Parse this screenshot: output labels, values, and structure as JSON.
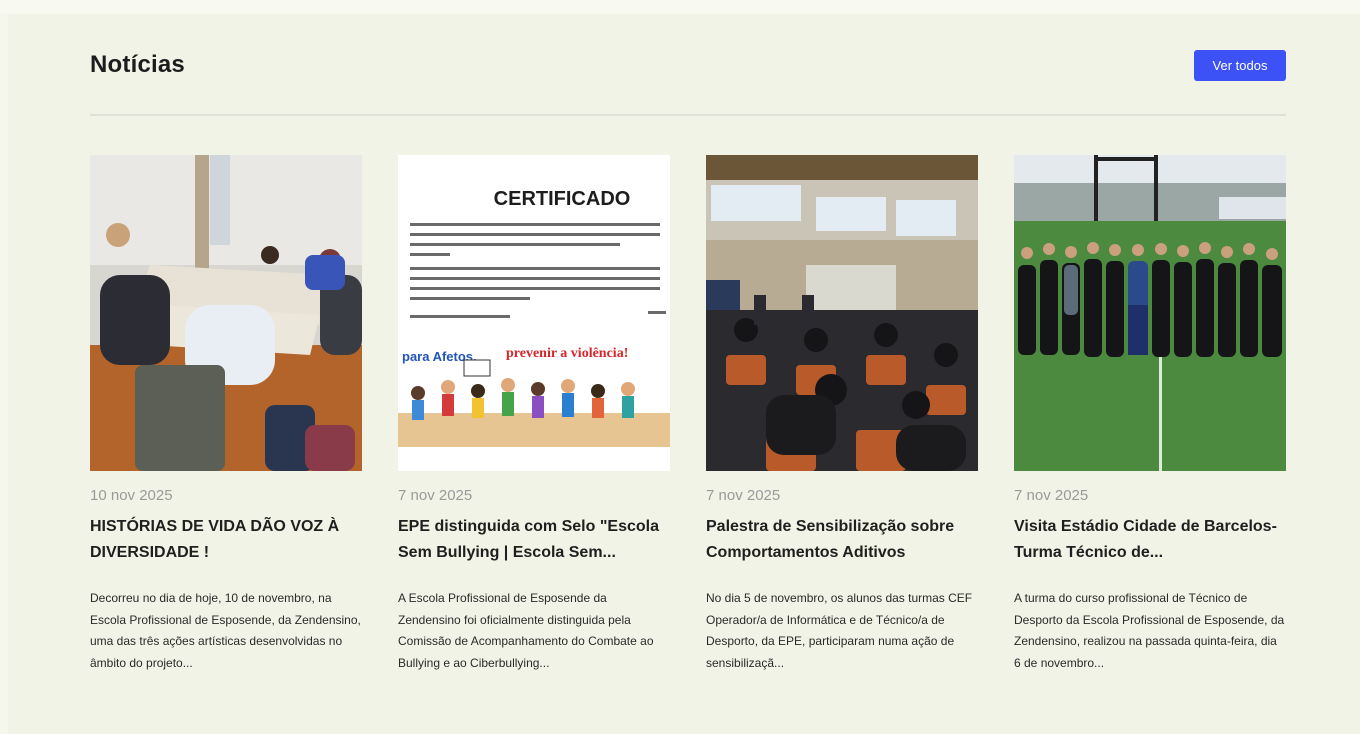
{
  "section": {
    "title": "Notícias",
    "see_all_label": "Ver todos"
  },
  "news": [
    {
      "date": "10 nov 2025",
      "title": "HISTÓRIAS DE VIDA DÃO VOZ À DIVERSIDADE !",
      "excerpt": "Decorreu no dia de hoje, 10 de novembro, na Escola Profissional de Esposende, da Zendensino, uma das três ações artísticas desenvolvidas no âmbito do projeto..."
    },
    {
      "date": "7 nov 2025",
      "title": "EPE distinguida com Selo \"Escola Sem Bullying | Escola Sem...",
      "excerpt": "A Escola Profissional de Esposende da Zendensino foi oficialmente distinguida pela Comissão de Acompanhamento do Combate ao Bullying e ao Ciberbullying...",
      "image_text": {
        "heading": "CERTIFICADO",
        "slogan_left": "para Afetos.",
        "slogan_right": "prevenir a violência!"
      }
    },
    {
      "date": "7 nov 2025",
      "title": "Palestra de Sensibilização sobre Comportamentos Aditivos",
      "excerpt": "No dia 5 de novembro, os alunos das turmas CEF Operador/a de Informática e de Técnico/a de Desporto, da EPE, participaram numa ação de sensibilizaçã..."
    },
    {
      "date": "7 nov 2025",
      "title": "Visita Estádio Cidade de Barcelos- Turma Técnico de...",
      "excerpt": "A turma do curso profissional de Técnico de Desporto da Escola Profissional de Esposende, da Zendensino, realizou na passada quinta-feira, dia 6 de novembro..."
    }
  ]
}
